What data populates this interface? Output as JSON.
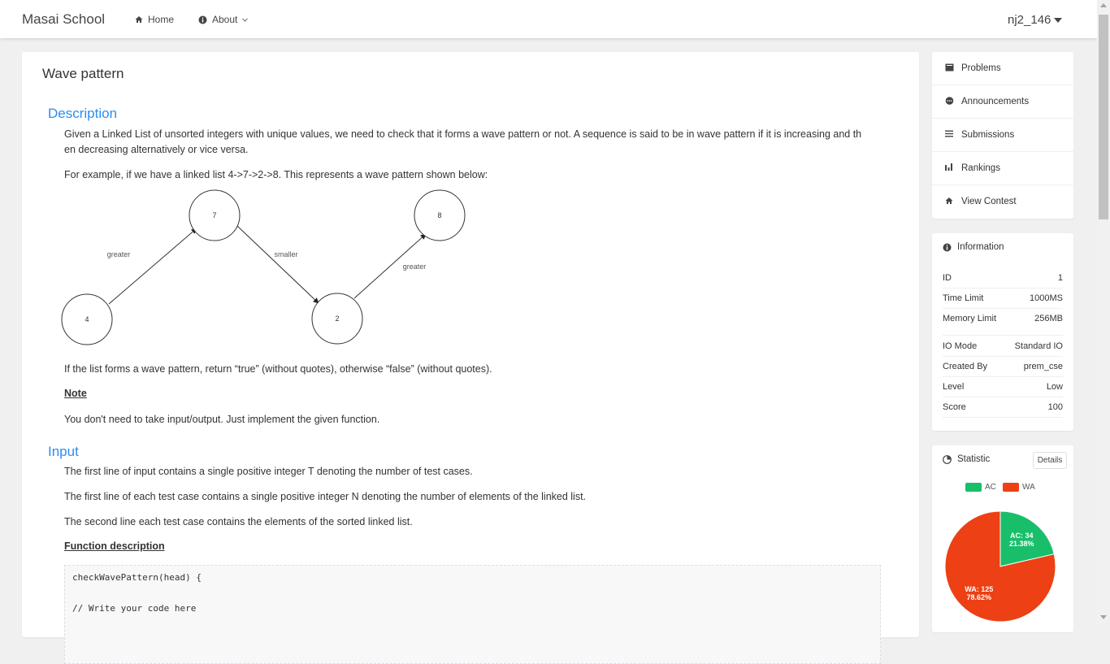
{
  "header": {
    "brand": "Masai School",
    "nav": [
      {
        "label": "Home",
        "icon": "home-icon"
      },
      {
        "label": "About",
        "icon": "info-icon"
      }
    ],
    "user": "nj2_146"
  },
  "problem": {
    "title": "Wave pattern",
    "description_heading": "Description",
    "desc_p1_line1": "Given a Linked List of unsorted integers with unique values, we need to check that it forms a wave pattern or not. A sequence is said to be in wave pattern if it is increasing and th",
    "desc_p1_line2": "en decreasing alternatively or vice versa.",
    "desc_p2": "For example, if we have a linked list 4->7->2->8. This represents a wave pattern shown below:",
    "diagram": {
      "nodes": [
        "4",
        "7",
        "2",
        "8"
      ],
      "edge_labels": [
        "greater",
        "smaller",
        "greater"
      ]
    },
    "desc_p3": "If the list forms a wave pattern, return “true” (without quotes), otherwise “false” (without quotes).",
    "note_heading": "Note",
    "note_text": "You don't need to take input/output. Just implement the given function.",
    "input_heading": "Input",
    "input_p1": "The first line of input contains a single positive integer T denoting the number of test cases.",
    "input_p2": "The first line of each test case contains a single positive integer N denoting the number of elements of the linked list.",
    "input_p3": "The second line each test case contains the elements of the sorted linked list.",
    "function_heading": "Function description",
    "code_line1": "checkWavePattern(head) {",
    "code_line2": "// Write your code here"
  },
  "sidebar": {
    "menu": [
      {
        "label": "Problems",
        "icon": "book-icon"
      },
      {
        "label": "Announcements",
        "icon": "chat-icon"
      },
      {
        "label": "Submissions",
        "icon": "list-icon"
      },
      {
        "label": "Rankings",
        "icon": "bar-chart-icon"
      },
      {
        "label": "View Contest",
        "icon": "home-icon"
      }
    ],
    "information": {
      "heading": "Information",
      "rows": [
        {
          "key": "ID",
          "value": "1"
        },
        {
          "key": "Time Limit",
          "value": "1000MS"
        },
        {
          "key": "Memory Limit",
          "value": "256MB"
        },
        {
          "key": "IO Mode",
          "value": "Standard IO"
        },
        {
          "key": "Created By",
          "value": "prem_cse"
        },
        {
          "key": "Level",
          "value": "Low"
        },
        {
          "key": "Score",
          "value": "100"
        }
      ]
    },
    "statistic": {
      "heading": "Statistic",
      "details_label": "Details",
      "ac_color": "#19be6b",
      "wa_color": "#ed4014"
    }
  },
  "chart_data": {
    "type": "pie",
    "categories": [
      "AC",
      "WA"
    ],
    "values": [
      34,
      125
    ],
    "percent_labels": [
      "21.38%",
      "78.62%"
    ],
    "slice_labels": [
      "AC: 34",
      "WA: 125"
    ],
    "legend": [
      "AC",
      "WA"
    ],
    "legend_position": "top",
    "colors": [
      "#19be6b",
      "#ed4014"
    ]
  }
}
